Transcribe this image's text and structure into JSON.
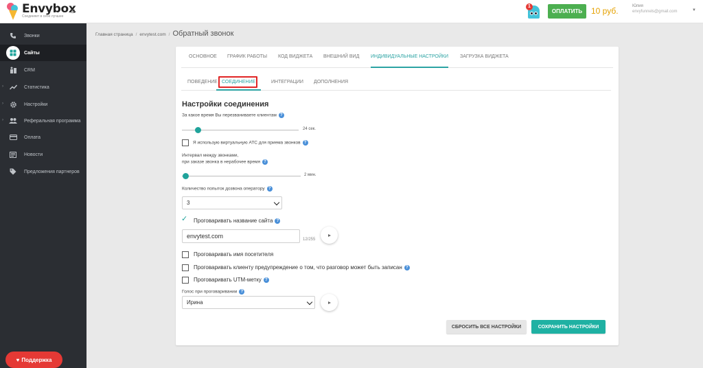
{
  "brand": {
    "name": "Envybox",
    "tagline": "Соединяет в себе лучшее"
  },
  "header": {
    "notification_count": "1",
    "pay_label": "ОПЛАТИТЬ",
    "balance": "10 руб.",
    "user_name": "Юлия",
    "user_email": "envyfunnels@gmail.com"
  },
  "sidebar": {
    "items": [
      {
        "label": "Звонки",
        "icon": "phone-icon"
      },
      {
        "label": "Сайты",
        "icon": "grid-icon"
      },
      {
        "label": "CRM",
        "icon": "crm-icon"
      },
      {
        "label": "Статистика",
        "icon": "chart-line-icon"
      },
      {
        "label": "Настройки",
        "icon": "gear-icon"
      },
      {
        "label": "Реферальная программа",
        "icon": "people-icon"
      },
      {
        "label": "Оплата",
        "icon": "card-icon"
      },
      {
        "label": "Новости",
        "icon": "news-icon"
      },
      {
        "label": "Предложения партнеров",
        "icon": "tag-icon"
      }
    ],
    "support_label": "Поддержка"
  },
  "breadcrumb": {
    "home": "Главная страница",
    "site": "envytest.com",
    "current": "Обратный звонок"
  },
  "tabs": [
    "ОСНОВНОЕ",
    "ГРАФИК РАБОТЫ",
    "КОД ВИДЖЕТА",
    "ВНЕШНИЙ ВИД",
    "ИНДИВИДУАЛЬНЫЕ НАСТРОЙКИ",
    "ЗАГРУЗКА ВИДЖЕТА"
  ],
  "subtabs": [
    "ПОВЕДЕНИЕ",
    "СОЕДИНЕНИЕ",
    "ИНТЕГРАЦИИ",
    "ДОПОЛНЕНИЯ"
  ],
  "form": {
    "title": "Настройки соединения",
    "callback_time_label": "За какое время Вы перезваниваете клиентам",
    "callback_time_value": "24 сек.",
    "virtual_pbx_label": "Я использую виртуальную АТС для приема звонков",
    "interval_label_1": "Интервал между звонками,",
    "interval_label_2": "при заказе звонка в нерабочее время",
    "interval_value": "2 мин.",
    "attempts_label": "Количество попыток дозвона оператору",
    "attempts_value": "3",
    "speak_site_label": "Проговаривать название сайта",
    "site_name_value": "envytest.com",
    "site_name_counter": "12/255",
    "speak_visitor_label": "Проговаривать имя посетителя",
    "speak_warning_label": "Проговаривать клиенту предупреждение о том, что разговор может быть записан",
    "speak_utm_label": "Проговаривать UTM-метку",
    "voice_label": "Голос при проговаривании",
    "voice_value": "Ирина",
    "reset_label": "СБРОСИТЬ ВСЕ НАСТРОЙКИ",
    "save_label": "СОХРАНИТЬ НАСТРОЙКИ"
  },
  "colors": {
    "accent": "#1fa39b",
    "pay": "#4caf50",
    "support": "#e53935",
    "sidebar": "#2b2e33"
  }
}
